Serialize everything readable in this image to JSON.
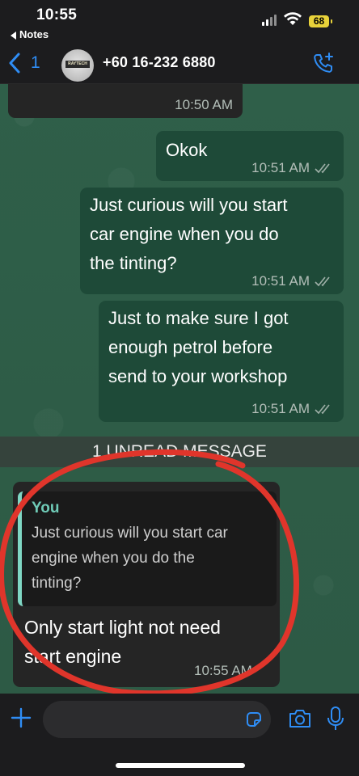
{
  "status_bar": {
    "time": "10:55",
    "back_app": "Notes",
    "battery": "68"
  },
  "header": {
    "back_count": "1",
    "contact": "+60 16-232 6880",
    "avatar_text": "RAYTECH"
  },
  "messages": [
    {
      "dir": "in",
      "text": "",
      "time": "10:50 AM"
    },
    {
      "dir": "out",
      "text": "Okok",
      "time": "10:51 AM",
      "status": "delivered"
    },
    {
      "dir": "out",
      "lines": [
        "Just curious will you start",
        "car engine when you do",
        "the tinting?"
      ],
      "time": "10:51 AM",
      "status": "delivered"
    },
    {
      "dir": "out",
      "lines": [
        "Just to make sure I got",
        "enough petrol before",
        "send to your workshop"
      ],
      "time": "10:51 AM",
      "status": "delivered"
    }
  ],
  "unread_label": "1 UNREAD MESSAGE",
  "reply": {
    "quote_author": "You",
    "quote_lines": [
      "Just curious will you start car",
      "engine when you do the",
      "tinting?"
    ],
    "lines": [
      "Only start light not need",
      "start engine"
    ],
    "time": "10:55 AM"
  },
  "input": {
    "placeholder": ""
  },
  "colors": {
    "accent_blue": "#2f8df5",
    "quote_accent": "#7fd7c4",
    "annotation_red": "#e0352b"
  }
}
